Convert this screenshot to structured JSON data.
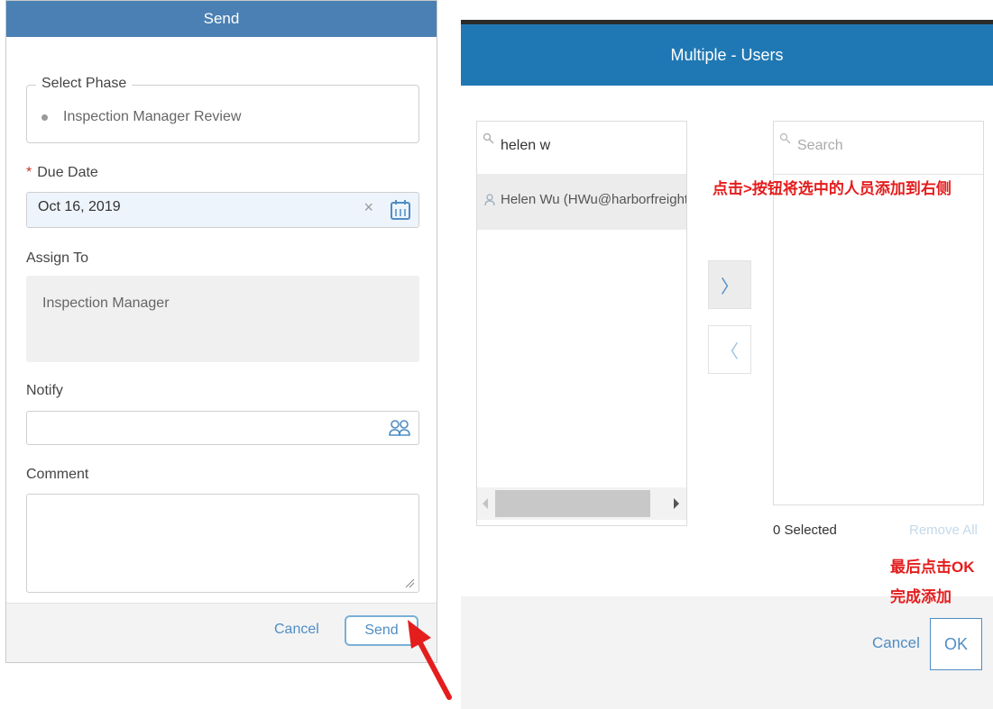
{
  "send_dialog": {
    "title": "Send",
    "select_phase": {
      "legend": "Select Phase",
      "value": "Inspection Manager Review"
    },
    "due_date": {
      "required_mark": "*",
      "label": "Due Date",
      "value": "Oct 16, 2019",
      "clear": "×"
    },
    "assign_to": {
      "label": "Assign To",
      "value": "Inspection Manager"
    },
    "notify": {
      "label": "Notify",
      "value": ""
    },
    "comment": {
      "label": "Comment",
      "value": ""
    },
    "footer": {
      "cancel": "Cancel",
      "send": "Send"
    }
  },
  "users_dialog": {
    "title": "Multiple - Users",
    "left_search": {
      "value": "helen w"
    },
    "results": [
      {
        "label": "Helen Wu (HWu@harborfreight.cc"
      }
    ],
    "right_search": {
      "placeholder": "Search"
    },
    "add_arrow": "〉",
    "remove_arrow": "〈",
    "selected_count": "0 Selected",
    "remove_all": "Remove All",
    "footer": {
      "cancel": "Cancel",
      "ok": "OK"
    }
  },
  "annotations": {
    "add_hint": "点击>按钮将选中的人员添加到右侧",
    "ok_hint_line1": "最后点击OK",
    "ok_hint_line2": "完成添加"
  },
  "colors": {
    "send_header": "#4a80b3",
    "users_header": "#1f78b4",
    "link_blue": "#4f8dc4",
    "annotation_red": "#e41d1d"
  }
}
